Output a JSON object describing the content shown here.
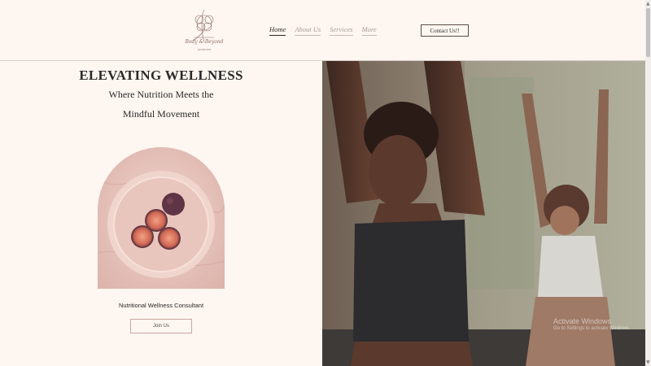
{
  "header": {
    "logo_icon": "floral-lotus-logo",
    "nav": [
      {
        "label": "Home",
        "active": true
      },
      {
        "label": "About Us",
        "active": false
      },
      {
        "label": "Services",
        "active": false
      },
      {
        "label": "More",
        "active": false
      }
    ],
    "contact_label": "Contact Us!!"
  },
  "hero": {
    "title": "ELEVATING WELLNESS",
    "subtitle_line1": "Where Nutrition Meets the",
    "subtitle_line2": "Mindful Movement",
    "consultant_label": "Nutritional Wellness Consultant",
    "join_label": "Join Us"
  },
  "watermark": {
    "line1": "Activate Windows",
    "line2": "Go to Settings to activate Windows."
  },
  "colors": {
    "background": "#fdf6f1",
    "accent": "#c9a9a3",
    "text": "#2b2a28"
  }
}
